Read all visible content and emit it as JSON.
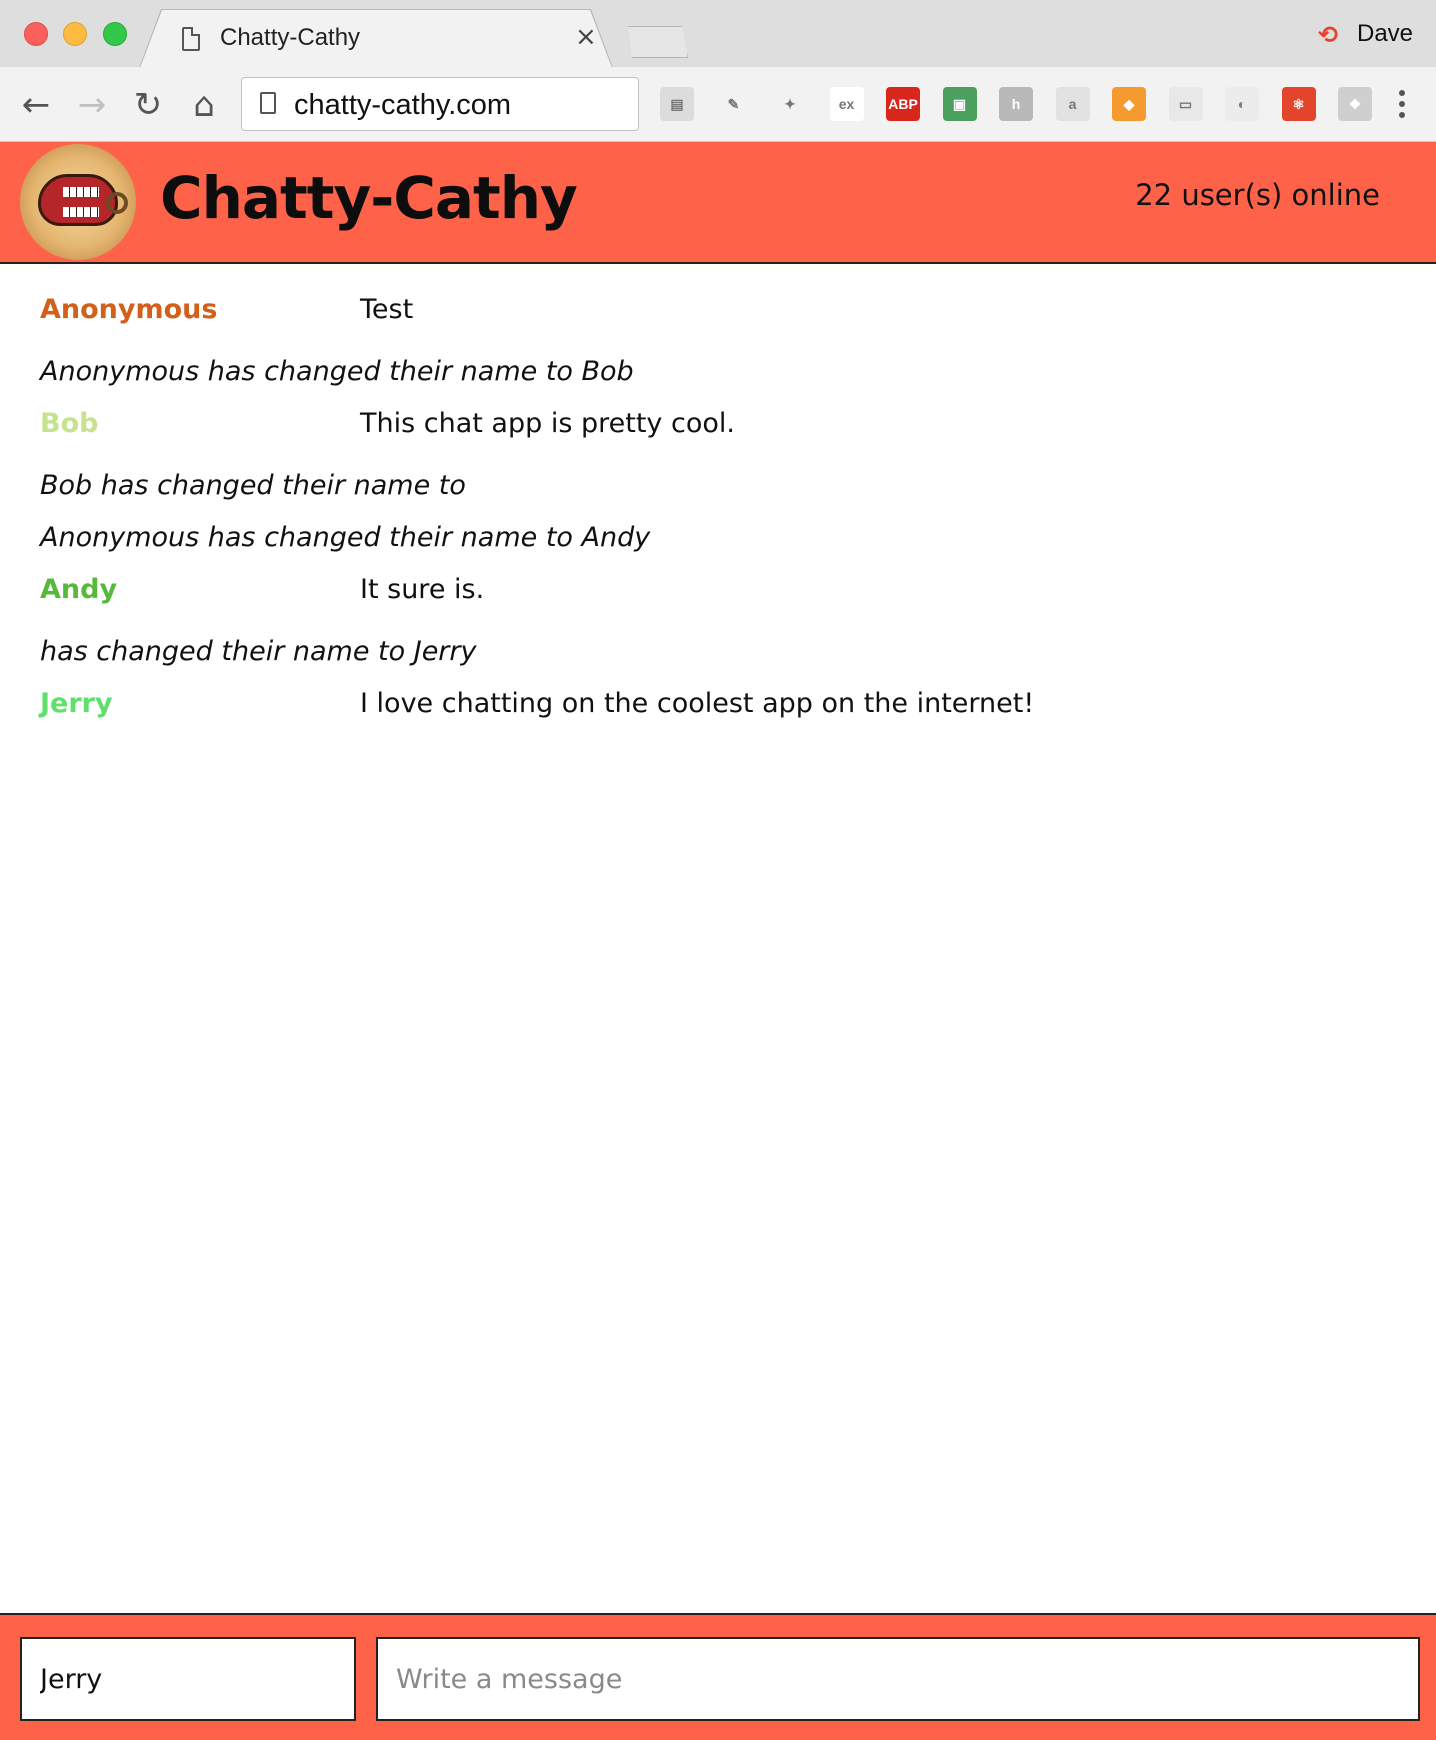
{
  "browser": {
    "tab_title": "Chatty-Cathy",
    "tab_close": "×",
    "profile_name": "Dave",
    "url": "chatty-cathy.com",
    "nav": {
      "back": "←",
      "forward": "→",
      "reload": "↻",
      "home": "⌂"
    },
    "extensions": [
      {
        "name": "reader-extension-icon",
        "label": "▤",
        "color": "#dcdcdc"
      },
      {
        "name": "eyedropper-extension-icon",
        "label": "✎",
        "color": "#f2f2f2"
      },
      {
        "name": "bird-extension-icon",
        "label": "✦",
        "color": "#f2f2f2"
      },
      {
        "name": "ex-extension-icon",
        "label": "ex",
        "color": "#ffffff"
      },
      {
        "name": "adblock-extension-icon",
        "label": "ABP",
        "color": "#d9261c"
      },
      {
        "name": "monitor-extension-icon",
        "label": "▣",
        "color": "#4aa05c"
      },
      {
        "name": "h-extension-icon",
        "label": "h",
        "color": "#b9b9b9"
      },
      {
        "name": "chat-extension-icon",
        "label": "a",
        "color": "#e2e2e2"
      },
      {
        "name": "metamask-extension-icon",
        "label": "◆",
        "color": "#f59a2f"
      },
      {
        "name": "card-extension-icon",
        "label": "▭",
        "color": "#e8e8e8"
      },
      {
        "name": "spinner-extension-icon",
        "label": "◐",
        "color": "#ececec"
      },
      {
        "name": "react-extension-icon",
        "label": "⚛",
        "color": "#e2452c"
      },
      {
        "name": "dropbox-extension-icon",
        "label": "❖",
        "color": "#cfcfcf"
      }
    ]
  },
  "app": {
    "title": "Chatty-Cathy",
    "users_online": "22 user(s) online",
    "messages": [
      {
        "type": "message",
        "user": "Anonymous",
        "color": "#d2601a",
        "content": "Test"
      },
      {
        "type": "notice",
        "text": "Anonymous has changed their name to Bob"
      },
      {
        "type": "message",
        "user": "Bob",
        "color": "#c5e38e",
        "content": "This chat app is pretty cool."
      },
      {
        "type": "notice",
        "text": "Bob has changed their name to"
      },
      {
        "type": "notice",
        "text": "Anonymous has changed their name to Andy"
      },
      {
        "type": "message",
        "user": "Andy",
        "color": "#57b93c",
        "content": "It sure is."
      },
      {
        "type": "notice",
        "text": "has changed their name to Jerry"
      },
      {
        "type": "message",
        "user": "Jerry",
        "color": "#5fe06a",
        "content": "I love chatting on the coolest app on the internet!"
      }
    ],
    "composer": {
      "name_value": "Jerry",
      "message_placeholder": "Write a message"
    }
  }
}
